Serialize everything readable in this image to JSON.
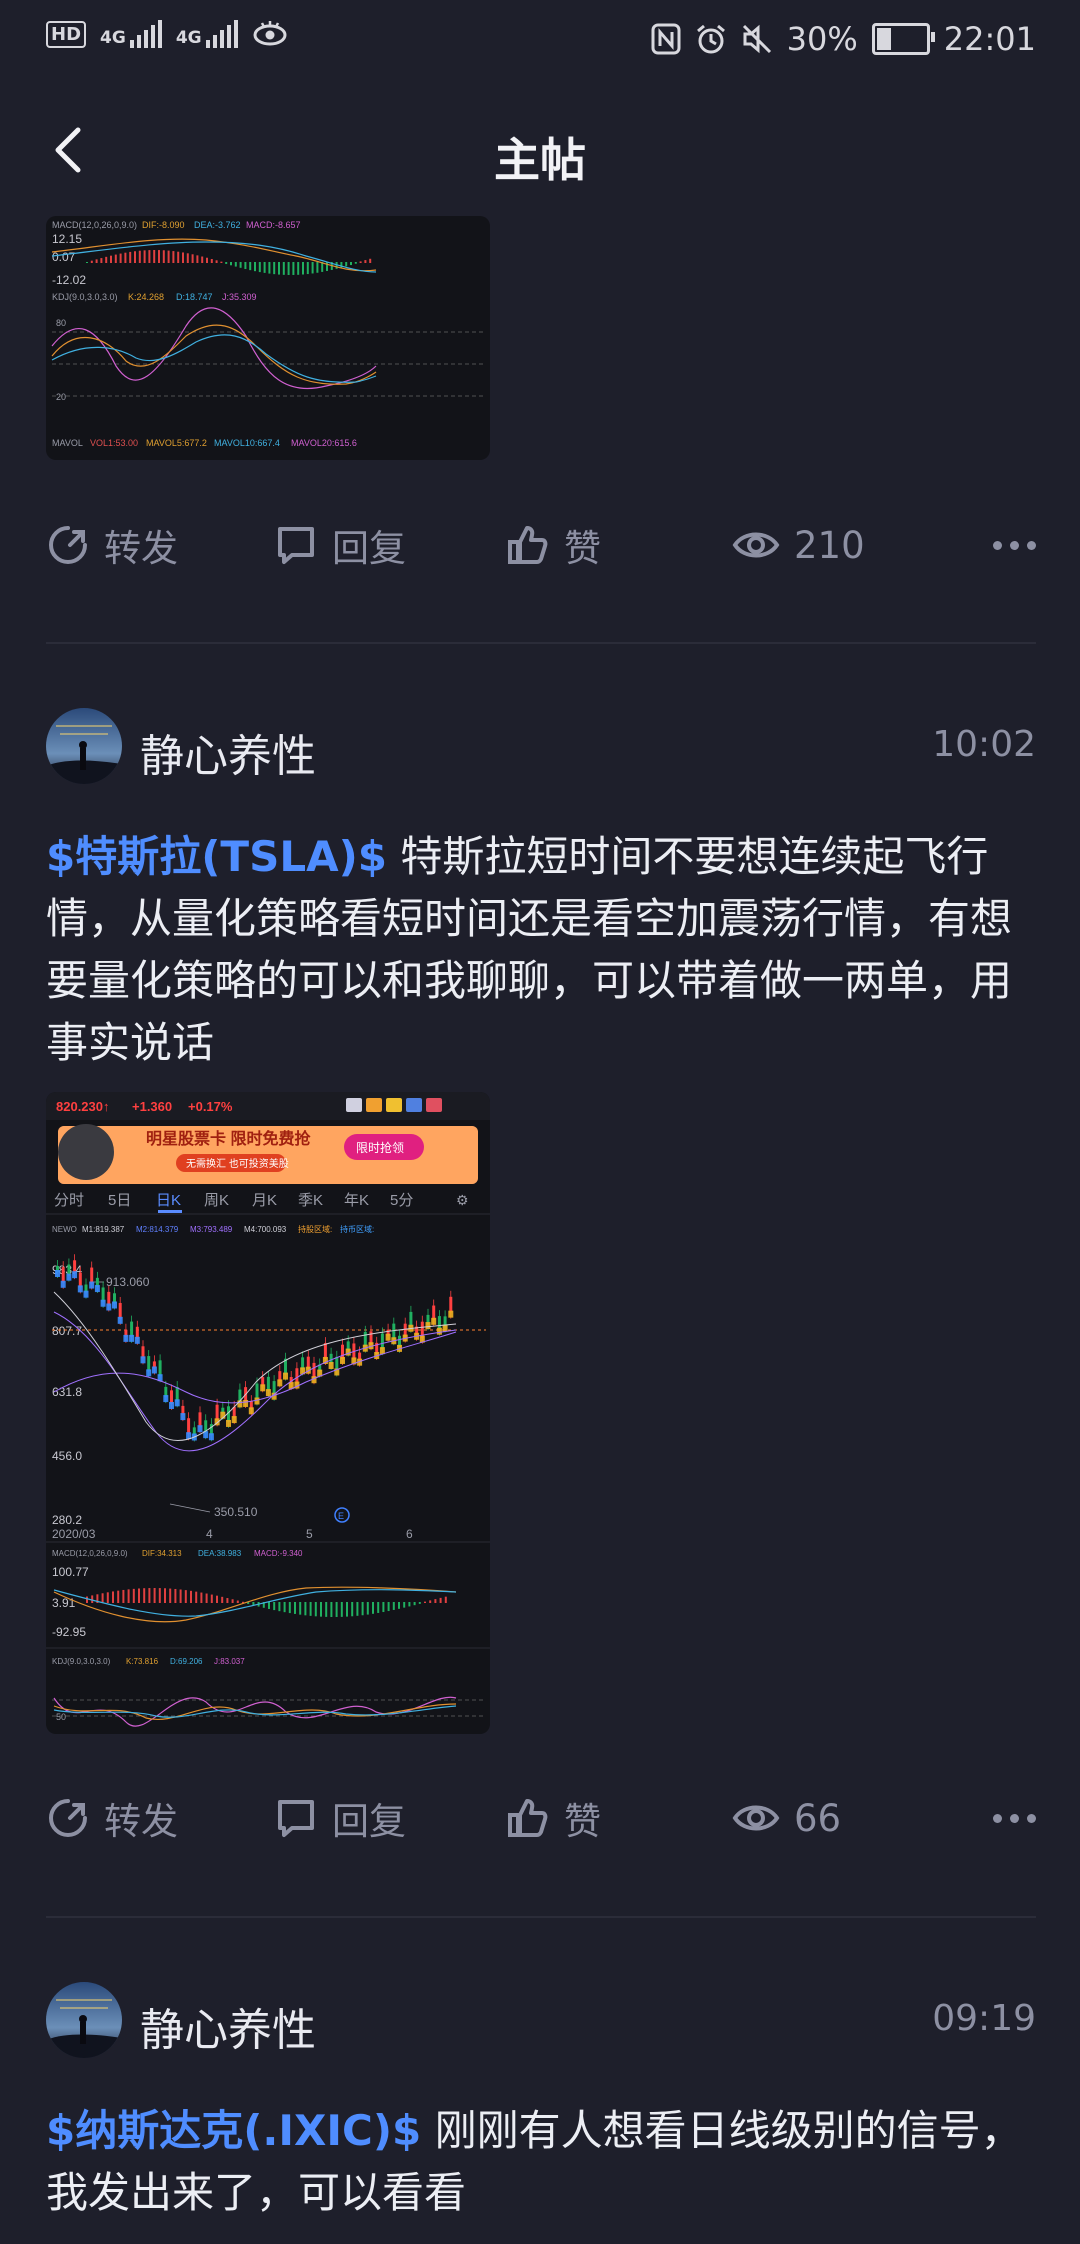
{
  "status": {
    "left_icons": [
      "hd-icon",
      "signal-4g-1-icon",
      "signal-4g-2-icon",
      "eye-icon"
    ],
    "network1": "4G",
    "network2": "4G",
    "battery": "30%",
    "battery_level": 0.3,
    "time": "22:01"
  },
  "nav": {
    "title": "主帖"
  },
  "post1": {
    "chart": {
      "macd_label": "MACD(12,0,26,0,9.0)",
      "macd_dif": "DIF:-8.090",
      "macd_dea": "DEA:-3.762",
      "macd_val": "MACD:-8.657",
      "y1": "12.15",
      "y2": "0.07",
      "y3": "-12.02",
      "kdj_label": "KDJ(9.0,3.0,3.0)",
      "kdj_k": "K:24.268",
      "kdj_d": "D:18.747",
      "kdj_j": "J:35.309",
      "kdj_80": "80",
      "kdj_20": "20",
      "mavol_label": "MAVOL",
      "vol": "VOL1:53.00",
      "mavol5": "MAVOL5:677.2",
      "mavol10": "MAVOL10:667.4",
      "mavol20": "MAVOL20:615.6"
    },
    "actions": {
      "repost": "转发",
      "reply": "回复",
      "like": "赞",
      "views": "210"
    }
  },
  "post2": {
    "username": "静心养性",
    "time": "10:02",
    "tag": "$特斯拉(TSLA)$",
    "text": " 特斯拉短时间不要想连续起飞行情，从量化策略看短时间还是看空加震荡行情，有想要量化策略的可以和我聊聊，可以带着做一两单，用事实说话",
    "chart": {
      "price": "820.230↑",
      "change": "+1.360",
      "pct": "+0.17%",
      "banner_text": "明星股票卡 限时免费抢",
      "banner_sub": "无需换汇 也可投资美股",
      "banner_btn": "限时抢领",
      "tabs": [
        "分时",
        "5日",
        "日K",
        "周K",
        "月K",
        "季K",
        "年K",
        "5分"
      ],
      "active_tab": "日K",
      "ma_name": "NEWO",
      "ma1": "M1:819.387",
      "ma2": "M2:814.379",
      "ma3": "M3:793.489",
      "ma4": "M4:700.093",
      "zone1": "持股区域:",
      "zone2": "持币区域:",
      "y_top": "983.4",
      "hi_label": "913.060",
      "y_807": "807.7",
      "y_631": "631.8",
      "y_456": "456.0",
      "y_280": "280.2",
      "lo_label": "350.510",
      "x_labels": [
        "2020/03",
        "4",
        "5",
        "6"
      ],
      "macd_label": "MACD(12,0,26,0,9.0)",
      "macd_dif": "DIF:34.313",
      "macd_dea": "DEA:38.983",
      "macd_val": "MACD:-9.340",
      "m_y1": "100.77",
      "m_y2": "3.91",
      "m_y3": "-92.95",
      "kdj_label": "KDJ(9.0,3.0,3.0)",
      "kdj_k": "K:73.816",
      "kdj_d": "D:69.206",
      "kdj_j": "J:83.037",
      "kdj_50": "50"
    },
    "actions": {
      "repost": "转发",
      "reply": "回复",
      "like": "赞",
      "views": "66"
    }
  },
  "post3": {
    "username": "静心养性",
    "time": "09:19",
    "tag": "$纳斯达克(.IXIC)$",
    "text": " 刚刚有人想看日线级别的信号，我发出来了，可以看看"
  },
  "colors": {
    "accent": "#4f8dff",
    "background": "#1e1f2b",
    "muted": "#8d90a3"
  }
}
